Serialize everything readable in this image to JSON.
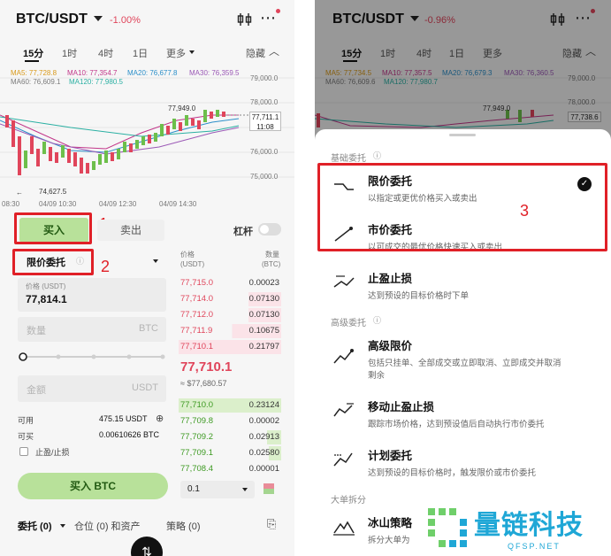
{
  "left": {
    "header": {
      "pair": "BTC/USDT",
      "change": "-1.00%",
      "icons": [
        "kline-compare-icon",
        "more-icon"
      ]
    },
    "tabs": [
      "15分",
      "1时",
      "4时",
      "1日",
      "更多",
      "隐藏"
    ],
    "ma_row1": [
      "MA5: 77,728.8",
      "MA10: 77,354.7",
      "MA20: 76,677.8",
      "MA30: 76,359.5"
    ],
    "ma_row2": [
      "MA60: 76,609.1",
      "MA120: 77,980.5"
    ],
    "axis_prices": [
      "79,000.0",
      "78,000.0",
      "76,000.0",
      "75,000.0"
    ],
    "high_label": "77,949.0",
    "low_label": "74,627.5",
    "last_price_box": [
      "77,711.1",
      "11:08"
    ],
    "time_labels": [
      "08:30",
      "04/09 10:30",
      "04/09 12:30",
      "04/09 14:30"
    ],
    "buy_tab": "买入",
    "sell_tab": "卖出",
    "leverage": "杠杆",
    "order_type": "限价委托",
    "price_label": "价格 (USDT)",
    "price_value": "77,814.1",
    "qty_placeholder": "数量",
    "qty_unit": "BTC",
    "amount_placeholder": "金额",
    "amount_unit": "USDT",
    "available_label": "可用",
    "available_value": "475.15 USDT",
    "buyable_label": "可买",
    "buyable_value": "0.00610626 BTC",
    "tpsl_label": "止盈/止损",
    "buy_button": "买入 BTC",
    "orderbook": {
      "price_header": [
        "价格",
        "(USDT)"
      ],
      "qty_header": [
        "数量",
        "(BTC)"
      ],
      "asks": [
        {
          "p": "77,715.0",
          "q": "0.00023"
        },
        {
          "p": "77,714.0",
          "q": "0.07130"
        },
        {
          "p": "77,712.0",
          "q": "0.07130"
        },
        {
          "p": "77,711.9",
          "q": "0.10675"
        },
        {
          "p": "77,710.1",
          "q": "0.21797"
        }
      ],
      "mid_price": "77,710.1",
      "mid_fiat": "≈ $77,680.57",
      "bids": [
        {
          "p": "77,710.0",
          "q": "0.23124"
        },
        {
          "p": "77,709.8",
          "q": "0.00002"
        },
        {
          "p": "77,709.2",
          "q": "0.02913"
        },
        {
          "p": "77,709.1",
          "q": "0.02580"
        },
        {
          "p": "77,708.4",
          "q": "0.00001"
        }
      ],
      "depth_select": "0.1"
    },
    "bottom_tabs": [
      "委托 (0)",
      "仓位 (0) 和资产",
      "策略 (0)"
    ],
    "annotations": [
      "1",
      "2"
    ]
  },
  "right": {
    "header": {
      "pair": "BTC/USDT",
      "change": "-0.96%"
    },
    "tabs": [
      "15分",
      "1时",
      "4时",
      "1日",
      "更多",
      "隐藏"
    ],
    "ma_row1": [
      "MA5: 77,734.5",
      "MA10: 77,357.5",
      "MA20: 76,679.3",
      "MA30: 76,360.5"
    ],
    "ma_row2": [
      "MA60: 76,609.6",
      "MA120: 77,980.7"
    ],
    "axis_prices": [
      "79,000.0",
      "78,000.0"
    ],
    "high_label": "77,949.0",
    "last_price_box": "77,738.6",
    "section_basic": "基础委托",
    "options": [
      {
        "title": "限价委托",
        "desc": "以指定或更优价格买入或卖出"
      },
      {
        "title": "市价委托",
        "desc": "以可成交的最优价格快速买入或卖出"
      },
      {
        "title": "止盈止损",
        "desc": "达到预设的目标价格时下单"
      }
    ],
    "section_advanced": "高级委托",
    "advanced": [
      {
        "title": "高级限价",
        "desc1": "包括只挂单、全部成交或立即取消、立即成交并取消",
        "desc2": "剩余"
      },
      {
        "title": "移动止盈止损",
        "desc1": "跟踪市场价格，达到预设值后自动执行市价委托"
      },
      {
        "title": "计划委托",
        "desc1": "达到预设的目标价格时，触发限价或市价委托"
      }
    ],
    "section_large": "大单拆分",
    "large": [
      {
        "title": "冰山策略",
        "desc1": "拆分大单为"
      }
    ],
    "annotation": "3",
    "watermark": {
      "main": "量链科技",
      "sub": "QFSP.NET"
    }
  }
}
